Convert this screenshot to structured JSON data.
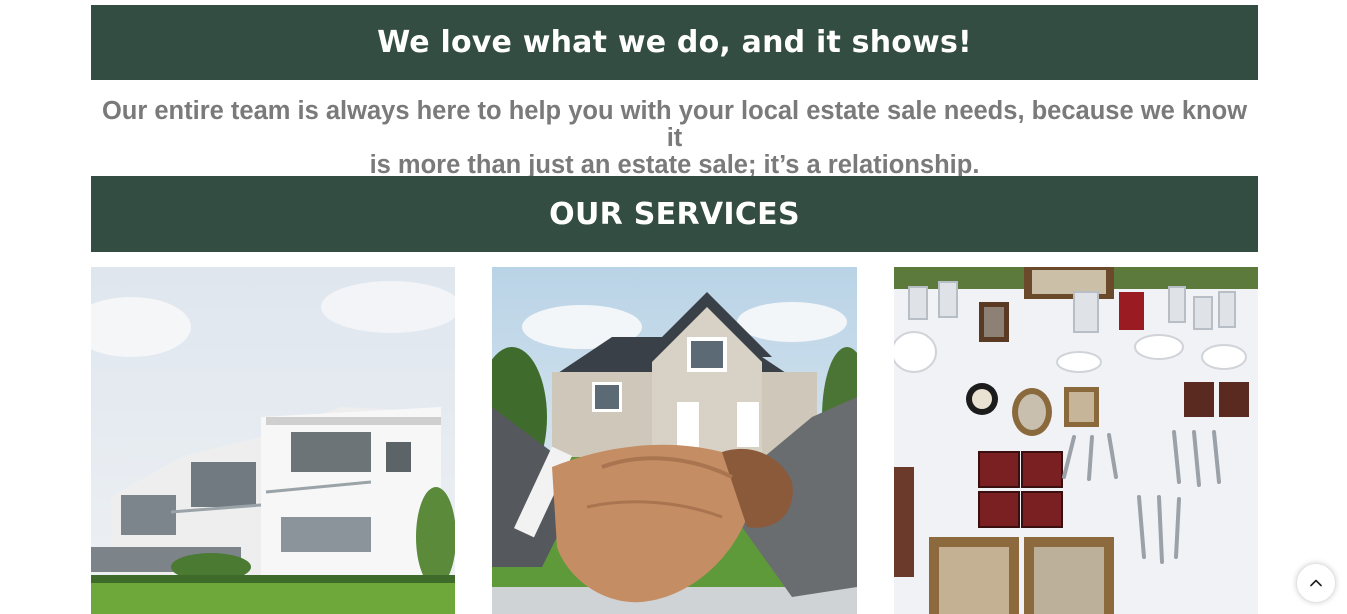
{
  "hero": {
    "heading": "We love what we do, and it shows!",
    "intro_line1": "Our entire team is always here to help you with your local estate sale needs, because we know it",
    "intro_line2": "is more than just an estate sale; it’s a relationship."
  },
  "services": {
    "heading": "OUR SERVICES",
    "cards": [
      {
        "image": "modern-house-photo"
      },
      {
        "image": "handshake-house-photo"
      },
      {
        "image": "antiques-table-photo"
      }
    ]
  },
  "controls": {
    "scroll_top_icon": "chevron-up-icon"
  },
  "colors": {
    "banner": "#344d42",
    "intro_text": "#7a7a7a"
  }
}
